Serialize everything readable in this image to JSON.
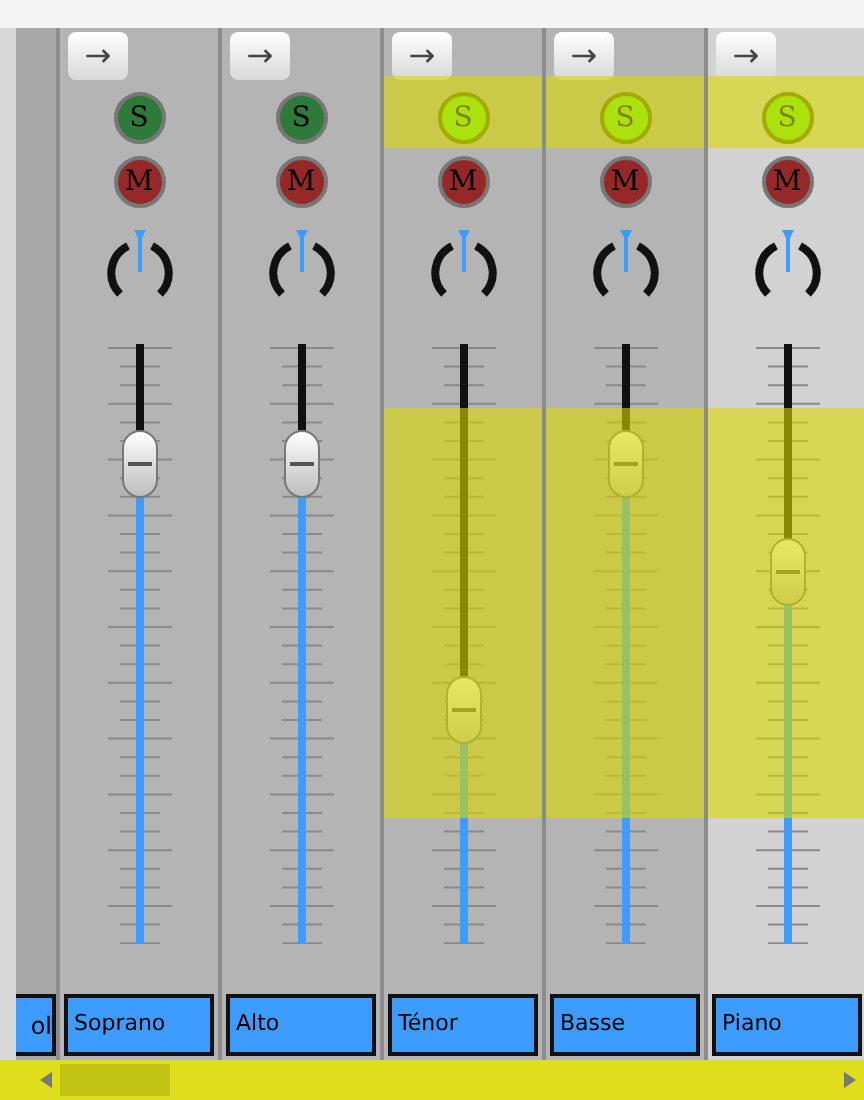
{
  "partial_strip": {
    "name": "ol"
  },
  "strips": [
    {
      "name": "Soprano",
      "route": "→",
      "solo": {
        "label": "S",
        "on": false
      },
      "mute": {
        "label": "M",
        "on": false
      },
      "level": 0.8,
      "selected": false,
      "highlighted": false
    },
    {
      "name": "Alto",
      "route": "→",
      "solo": {
        "label": "S",
        "on": false
      },
      "mute": {
        "label": "M",
        "on": false
      },
      "level": 0.8,
      "selected": false,
      "highlighted": false
    },
    {
      "name": "Ténor",
      "route": "→",
      "solo": {
        "label": "S",
        "on": true
      },
      "mute": {
        "label": "M",
        "on": false
      },
      "level": 0.39,
      "selected": false,
      "highlighted": true
    },
    {
      "name": "Basse",
      "route": "→",
      "solo": {
        "label": "S",
        "on": true
      },
      "mute": {
        "label": "M",
        "on": false
      },
      "level": 0.8,
      "selected": false,
      "highlighted": true
    },
    {
      "name": "Piano",
      "route": "→",
      "solo": {
        "label": "S",
        "on": true
      },
      "mute": {
        "label": "M",
        "on": false
      },
      "level": 0.62,
      "selected": true,
      "highlighted": true
    }
  ],
  "scrollbar": {
    "highlighted": true
  }
}
